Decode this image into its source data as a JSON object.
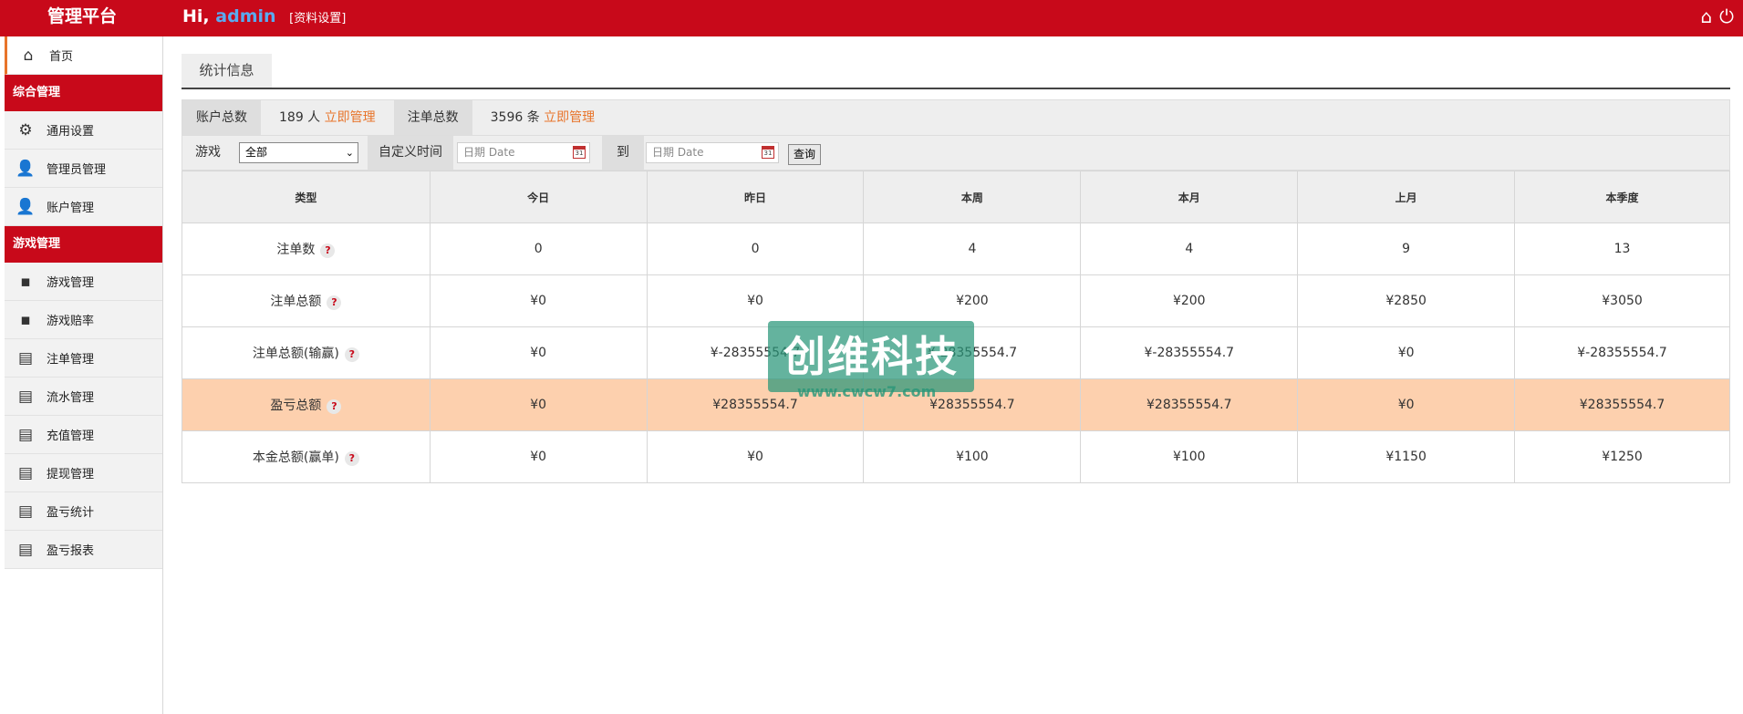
{
  "header": {
    "brand": "管理平台",
    "greeting": "Hi,",
    "username": "admin",
    "profile_link": "[资料设置]",
    "home_icon": "home-icon",
    "power_icon": "power-icon"
  },
  "sidebar": {
    "home": {
      "label": "首页",
      "icon": "home-icon"
    },
    "section1": "综合管理",
    "group1": [
      {
        "label": "通用设置",
        "icon": "gear-icon"
      },
      {
        "label": "管理员管理",
        "icon": "user-manage-icon"
      },
      {
        "label": "账户管理",
        "icon": "user-icon"
      }
    ],
    "section2": "游戏管理",
    "group2": [
      {
        "label": "游戏管理",
        "icon": "grid-icon"
      },
      {
        "label": "游戏赔率",
        "icon": "grid-icon"
      },
      {
        "label": "注单管理",
        "icon": "doc-icon"
      },
      {
        "label": "流水管理",
        "icon": "doc-icon"
      },
      {
        "label": "充值管理",
        "icon": "doc-icon"
      },
      {
        "label": "提现管理",
        "icon": "doc-icon"
      },
      {
        "label": "盈亏统计",
        "icon": "doc-icon"
      },
      {
        "label": "盈亏报表",
        "icon": "doc-icon"
      }
    ]
  },
  "tab": {
    "label": "统计信息"
  },
  "stats": {
    "accounts_label": "账户总数",
    "accounts_value": "189 人",
    "accounts_link": "立即管理",
    "bets_label": "注单总数",
    "bets_value": "3596 条",
    "bets_link": "立即管理"
  },
  "filter": {
    "game_label": "游戏",
    "game_selected": "全部",
    "custom_time_label": "自定义时间",
    "date_placeholder_from": "日期 Date",
    "to_label": "到",
    "date_placeholder_to": "日期 Date",
    "query_button": "查询",
    "calendar_icon": "calendar-icon"
  },
  "table": {
    "headers": [
      "类型",
      "今日",
      "昨日",
      "本周",
      "本月",
      "上月",
      "本季度"
    ],
    "rows": [
      {
        "type": "注单数",
        "help": "?",
        "cells": [
          "0",
          "0",
          "4",
          "4",
          "9",
          "13"
        ]
      },
      {
        "type": "注单总额",
        "help": "?",
        "cells": [
          "¥0",
          "¥0",
          "¥200",
          "¥200",
          "¥2850",
          "¥3050"
        ]
      },
      {
        "type": "注单总额(输赢)",
        "help": "?",
        "cells": [
          "¥0",
          "¥-28355554.7",
          "¥-28355554.7",
          "¥-28355554.7",
          "¥0",
          "¥-28355554.7"
        ]
      },
      {
        "type": "盈亏总额",
        "help": "?",
        "cells": [
          "¥0",
          "¥28355554.7",
          "¥28355554.7",
          "¥28355554.7",
          "¥0",
          "¥28355554.7"
        ]
      },
      {
        "type": "本金总额(赢单)",
        "help": "?",
        "cells": [
          "¥0",
          "¥0",
          "¥100",
          "¥100",
          "¥1150",
          "¥1250"
        ]
      }
    ]
  },
  "watermark": {
    "text": "创维科技",
    "url": "www.cwcw7.com"
  },
  "colors": {
    "brand_red": "#c8091a",
    "accent_orange": "#e8742a",
    "highlight_row": "#fdd0ae"
  }
}
